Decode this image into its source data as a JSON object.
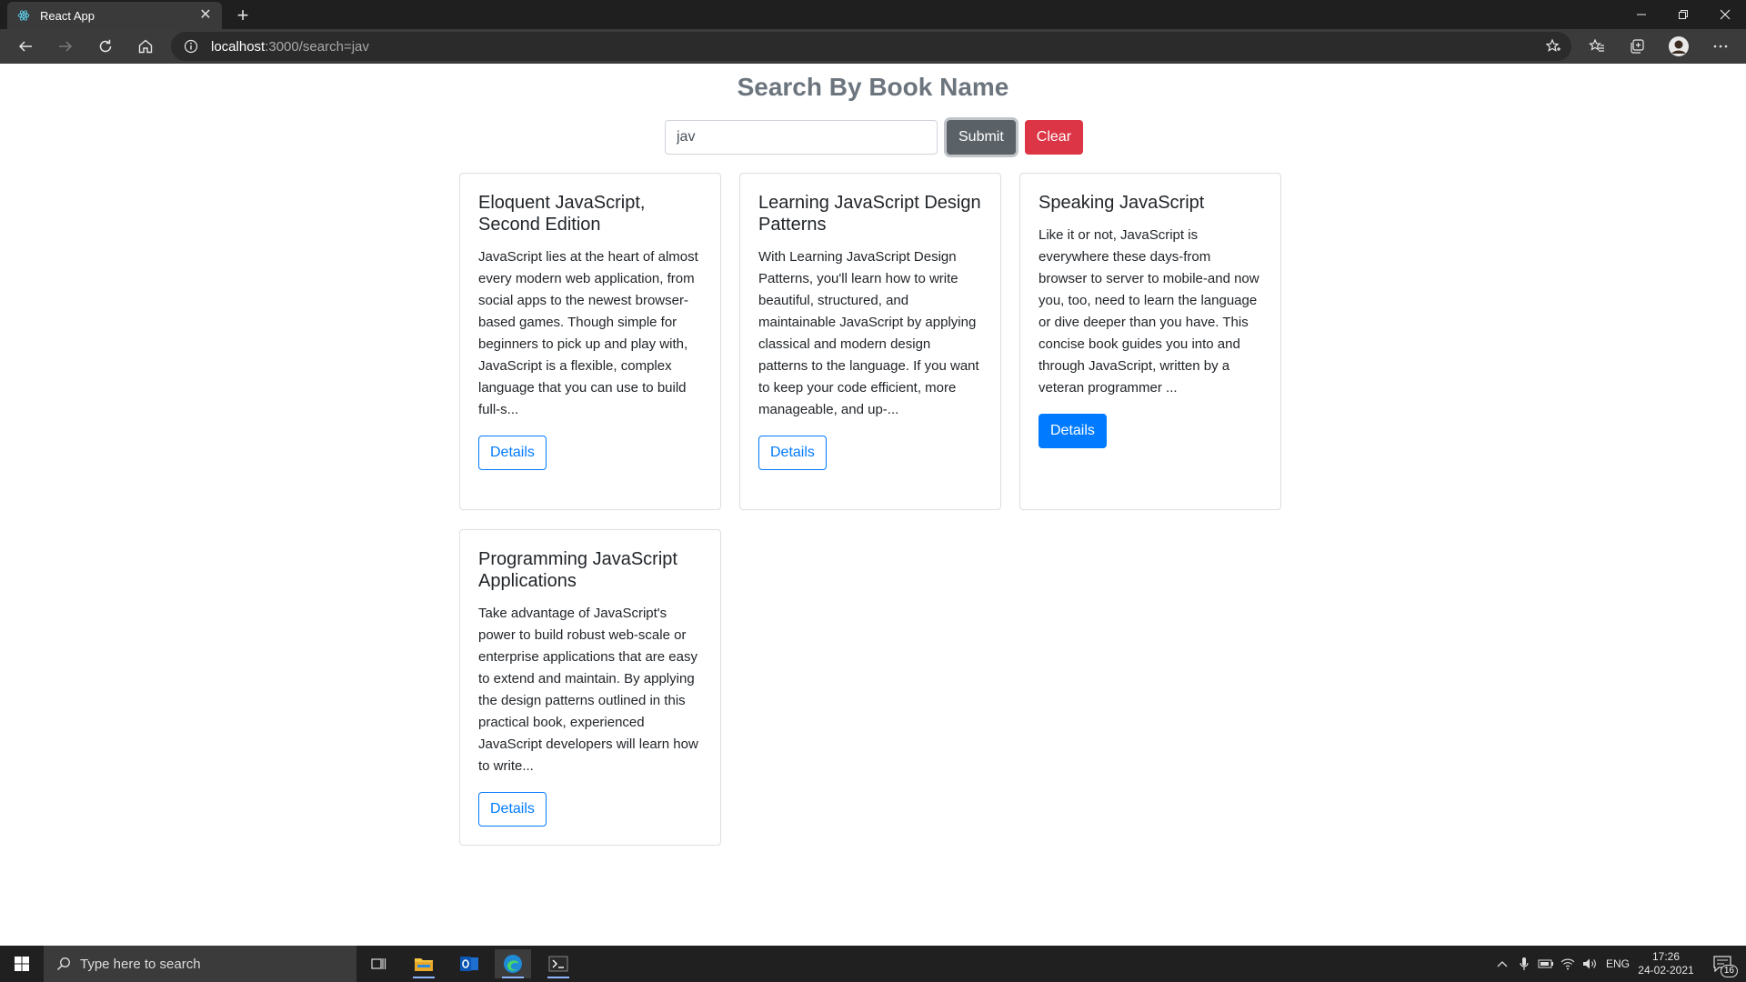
{
  "browser": {
    "tab_title": "React App",
    "close_glyph": "✕",
    "new_tab_glyph": "+",
    "address_host": "localhost",
    "address_path": ":3000/search=jav"
  },
  "page": {
    "heading": "Search By Book Name",
    "search_value": "jav",
    "submit_label": "Submit",
    "clear_label": "Clear"
  },
  "books": [
    {
      "title": "Eloquent JavaScript, Second Edition",
      "description": "JavaScript lies at the heart of almost every modern web application, from social apps to the newest browser-based games. Though simple for beginners to pick up and play with, JavaScript is a flexible, complex language that you can use to build full-s...",
      "details_label": "Details"
    },
    {
      "title": "Learning JavaScript Design Patterns",
      "description": "With Learning JavaScript Design Patterns, you'll learn how to write beautiful, structured, and maintainable JavaScript by applying classical and modern design patterns to the language. If you want to keep your code efficient, more manageable, and up-...",
      "details_label": "Details"
    },
    {
      "title": "Speaking JavaScript",
      "description": "Like it or not, JavaScript is everywhere these days-from browser to server to mobile-and now you, too, need to learn the language or dive deeper than you have. This concise book guides you into and through JavaScript, written by a veteran programmer ...",
      "details_label": "Details"
    },
    {
      "title": "Programming JavaScript Applications",
      "description": "Take advantage of JavaScript's power to build robust web-scale or enterprise applications that are easy to extend and maintain. By applying the design patterns outlined in this practical book, experienced JavaScript developers will learn how to write...",
      "details_label": "Details"
    }
  ],
  "taskbar": {
    "search_placeholder": "Type here to search",
    "language": "ENG",
    "time": "17:26",
    "date": "24-02-2021",
    "notification_count": "16"
  },
  "colors": {
    "primary": "#007bff",
    "danger": "#dc3545",
    "secondary": "#6c757d"
  }
}
